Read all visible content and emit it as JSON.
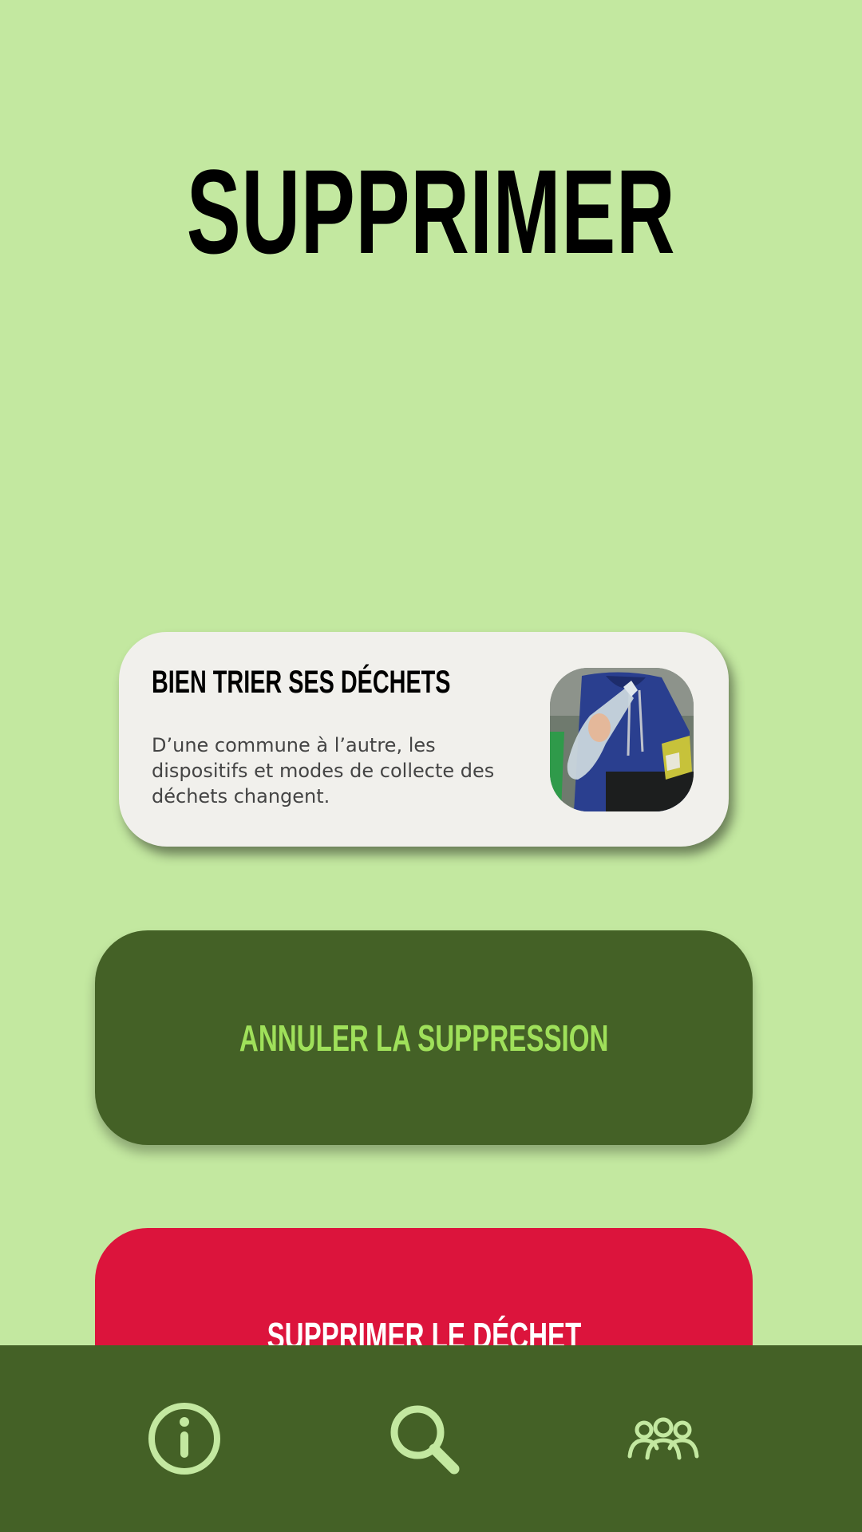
{
  "page": {
    "title": "SUPPRIMER"
  },
  "card": {
    "title": "BIEN TRIER SES DÉCHETS",
    "description": "D’une commune à l’autre, les dispositifs et modes de collecte des déchets changent.",
    "image_icon": "recycling-photo"
  },
  "actions": {
    "cancel_label": "ANNULER LA SUPPRESSION",
    "delete_label": "SUPPRIMER LE DÉCHET"
  },
  "nav": {
    "items": [
      {
        "icon": "info-icon"
      },
      {
        "icon": "search-icon"
      },
      {
        "icon": "users-icon"
      }
    ]
  },
  "colors": {
    "background": "#c3e8a0",
    "dark_green": "#446126",
    "accent_green": "#9fe05a",
    "danger_red": "#dc143c",
    "card_bg": "#f1f0ec",
    "nav_icon": "#c3e8a0"
  }
}
